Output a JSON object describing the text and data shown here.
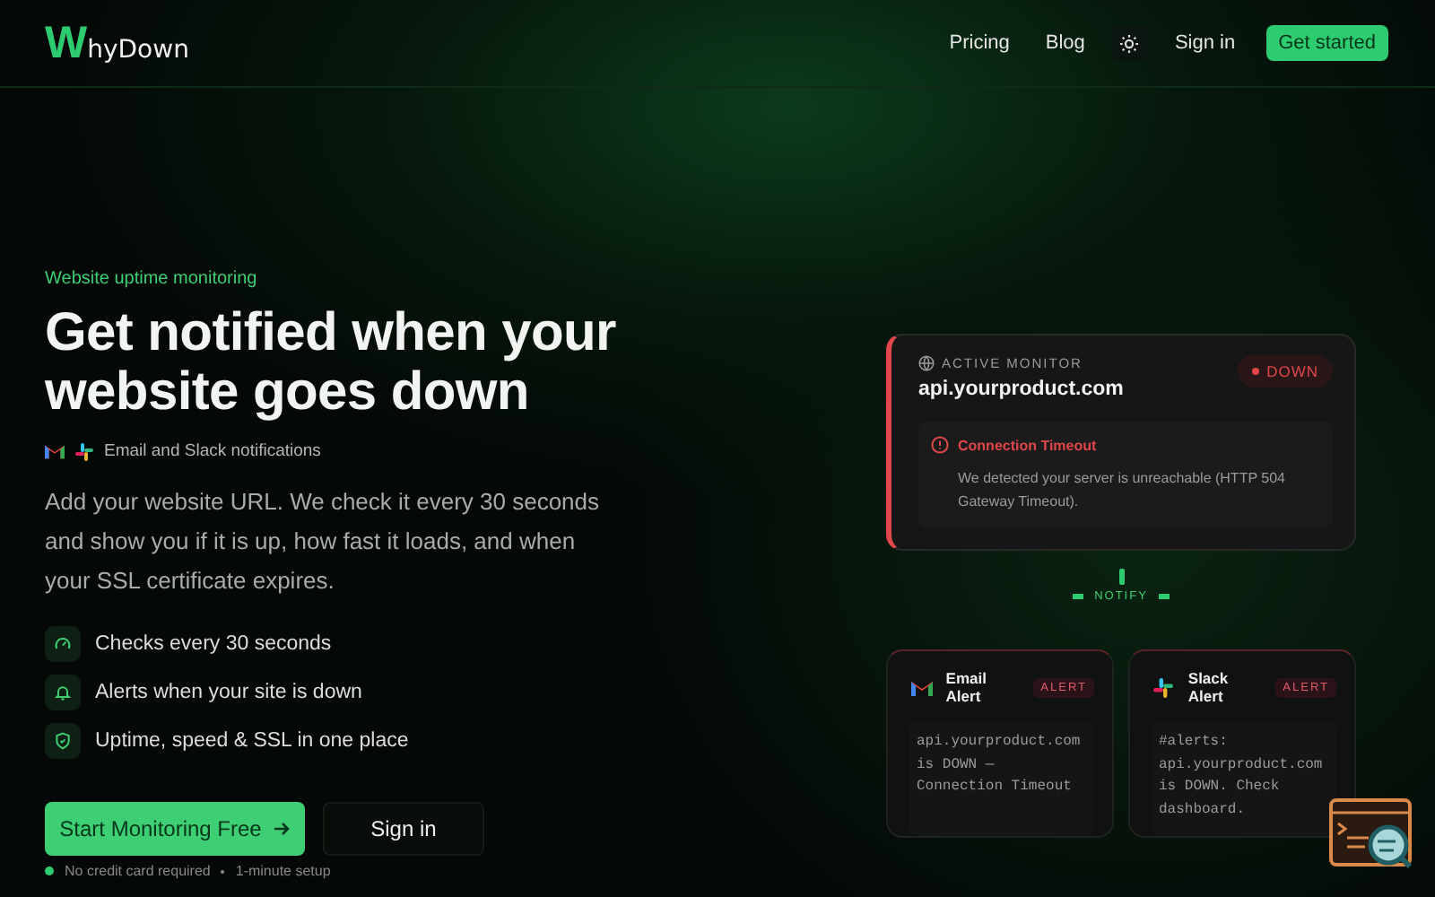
{
  "nav": {
    "logo_mark": "W",
    "logo_text": "hyDown",
    "links": [
      "Pricing",
      "Blog"
    ],
    "sign_in": "Sign in",
    "cta": "Get started"
  },
  "hero": {
    "eyebrow": "Website uptime monitoring",
    "title": "Get notified when your website goes down",
    "channels": "Email and Slack notifications",
    "description": "Add your website URL. We check it every 30 seconds and show you if it is up, how fast it loads, and when your SSL certificate expires.",
    "features": [
      {
        "kind": "speed",
        "text": "Checks every 30 seconds"
      },
      {
        "kind": "bell",
        "text": "Alerts when your site is down"
      },
      {
        "kind": "shield",
        "text": "Uptime, speed & SSL in one place"
      }
    ],
    "primary": "Start Monitoring Free",
    "secondary": "Sign in",
    "notes": [
      "No credit card required",
      "1-minute setup"
    ]
  },
  "monitor": {
    "label": "ACTIVE MONITOR",
    "url": "api.yourproduct.com",
    "status": "DOWN",
    "error_title": "Connection Timeout",
    "error_text": "We detected your server is unreachable (HTTP 504 Gateway Timeout).",
    "connector": "NOTIFY"
  },
  "alerts": [
    {
      "kind": "email",
      "title": "Email Alert",
      "badge": "ALERT",
      "message": "api.yourproduct.com is DOWN — Connection Timeout"
    },
    {
      "kind": "slack",
      "title": "Slack Alert",
      "badge": "ALERT",
      "message": "#alerts: api.yourproduct.com is DOWN. Check dashboard."
    }
  ]
}
